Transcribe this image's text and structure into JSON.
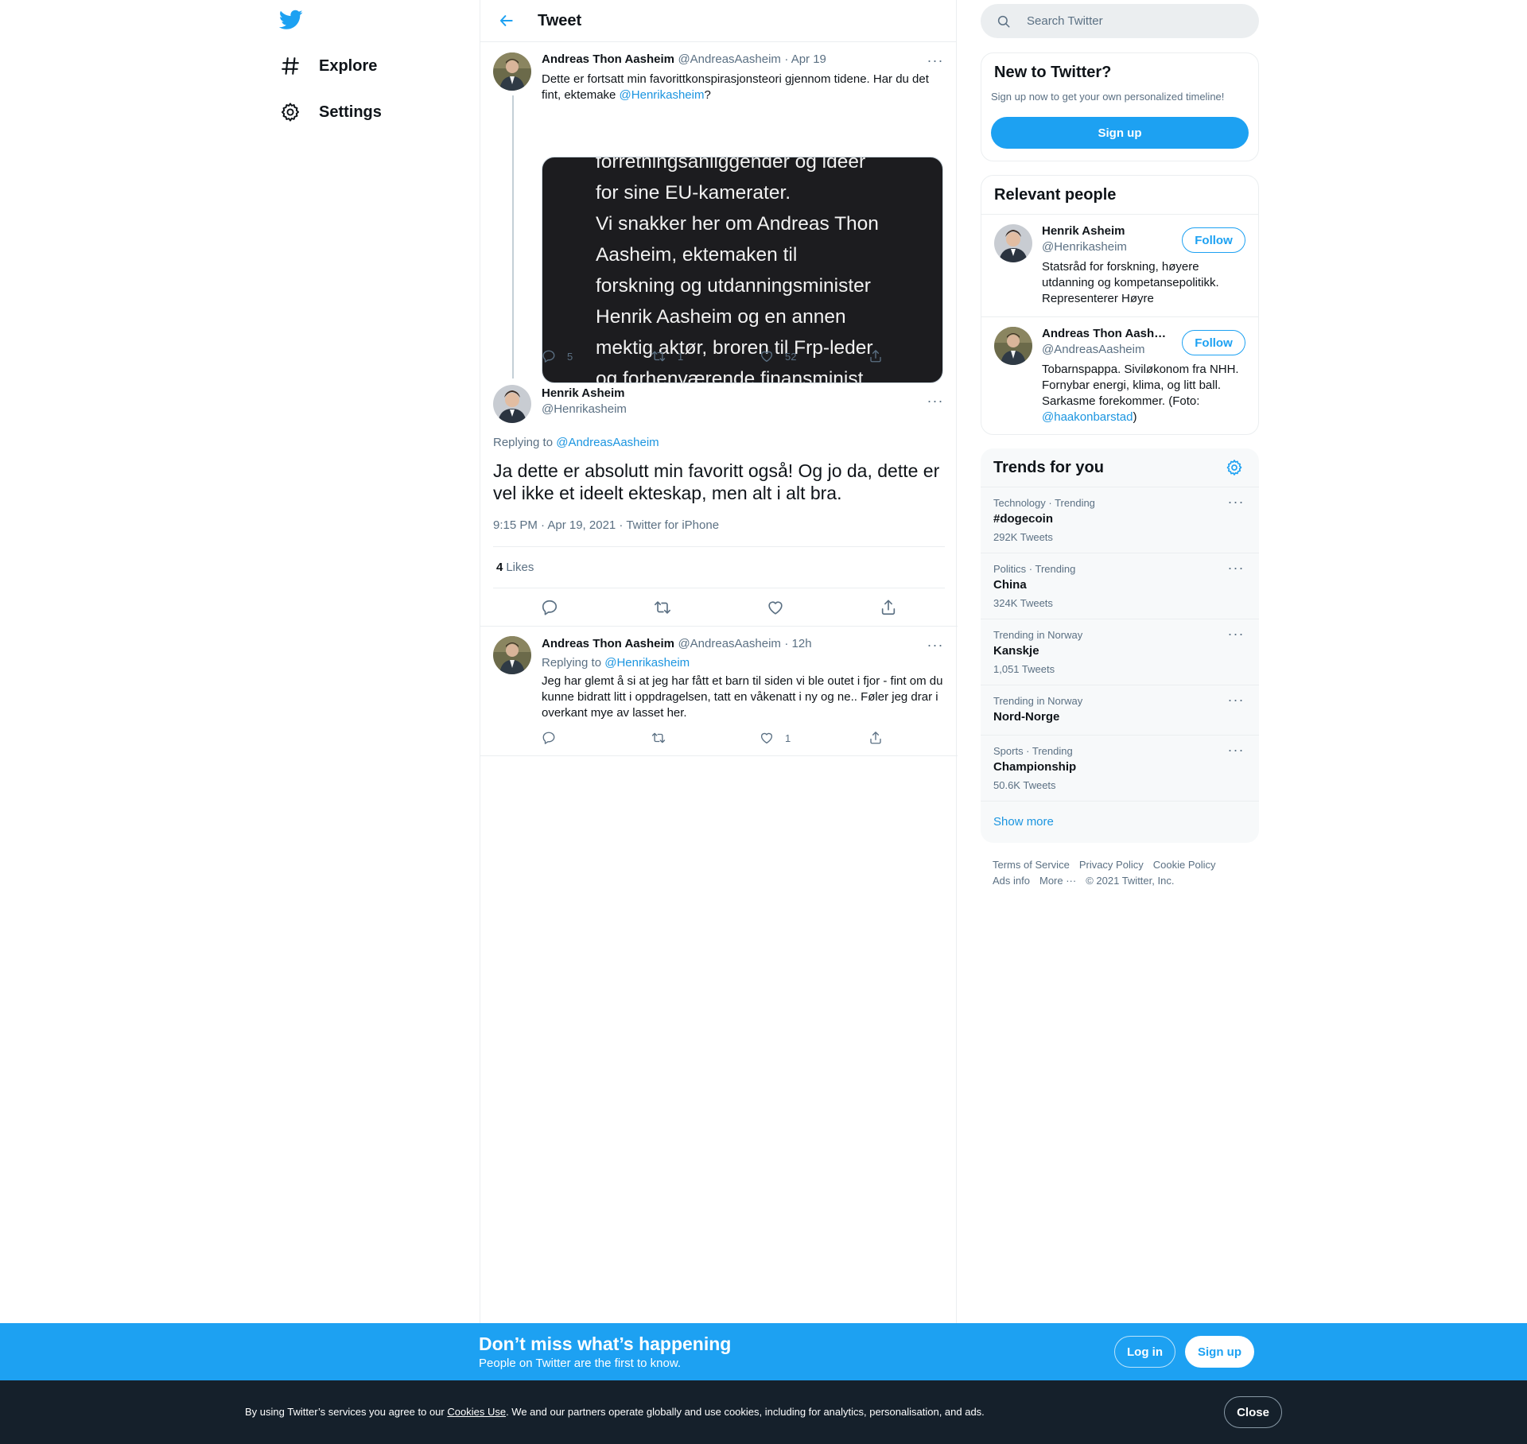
{
  "nav": {
    "explore_label": "Explore",
    "settings_label": "Settings"
  },
  "header": {
    "title": "Tweet"
  },
  "tweet1": {
    "name": "Andreas Thon Aasheim",
    "handle": "@AndreasAasheim",
    "time": "· Apr 19",
    "text_before": "Dette er fortsatt min favorittkonspirasjonsteori gjennom tidene. Har du det fint, ektemake ",
    "mention": "@Henrikasheim",
    "text_after": "?",
    "image_lines": [
      "forretningsanliggender og ideer",
      "for sine EU-kamerater.",
      "Vi snakker her om Andreas Thon",
      "Aasheim, ektemaken til",
      "forskning og utdanningsminister",
      "Henrik Aasheim og en annen",
      "mektig aktør, broren til Frp-leder",
      "og forhenværende finansminist..."
    ],
    "replies": "5",
    "retweets": "1",
    "likes": "52"
  },
  "main_tweet": {
    "name": "Henrik Asheim",
    "handle": "@Henrikasheim",
    "replying_prefix": "Replying to ",
    "replying_to": "@AndreasAasheim",
    "text": "Ja dette er absolutt min favoritt også! Og jo da, dette er vel ikke et ideelt ekteskap, men alt i alt bra.",
    "timestamp": "9:15 PM · Apr 19, 2021 · Twitter for iPhone",
    "likes_count": "4",
    "likes_label": "Likes"
  },
  "reply": {
    "name": "Andreas Thon Aasheim",
    "handle": "@AndreasAasheim",
    "time": "· 12h",
    "replying_prefix": "Replying to ",
    "replying_to": "@Henrikasheim",
    "text": "Jeg har glemt å si at jeg har fått et barn til siden vi ble outet i fjor - fint om du kunne bidratt litt i oppdragelsen, tatt en våkenatt i ny og ne.. Føler jeg drar i overkant mye av lasset her.",
    "likes": "1"
  },
  "search": {
    "placeholder": "Search Twitter"
  },
  "new_to_twitter": {
    "title": "New to Twitter?",
    "subtitle": "Sign up now to get your own personalized timeline!",
    "button": "Sign up"
  },
  "relevant_people": {
    "title": "Relevant people",
    "people": [
      {
        "name": "Henrik Asheim",
        "handle": "@Henrikasheim",
        "bio": "Statsråd for forskning, høyere utdanning og kompetansepolitikk. Representerer Høyre",
        "follow": "Follow"
      },
      {
        "name": "Andreas Thon Aash…",
        "handle": "@AndreasAasheim",
        "bio_before": "Tobarnspappa. Siviløkonom fra NHH. Fornybar energi, klima, og litt ball. Sarkasme forekommer. (Foto: ",
        "bio_link": "@haakonbarstad",
        "bio_after": ")",
        "follow": "Follow"
      }
    ]
  },
  "trends": {
    "title": "Trends for you",
    "items": [
      {
        "category": "Technology · Trending",
        "name": "#dogecoin",
        "count": "292K Tweets"
      },
      {
        "category": "Politics · Trending",
        "name": "China",
        "count": "324K Tweets"
      },
      {
        "category": "Trending in Norway",
        "name": "Kanskje",
        "count": "1,051 Tweets"
      },
      {
        "category": "Trending in Norway",
        "name": "Nord-Norge",
        "count": ""
      },
      {
        "category": "Sports · Trending",
        "name": "Championship",
        "count": "50.6K Tweets"
      }
    ],
    "show_more": "Show more"
  },
  "footer": {
    "terms": "Terms of Service",
    "privacy": "Privacy Policy",
    "cookie": "Cookie Policy",
    "ads": "Ads info",
    "more": "More ···",
    "copyright": "© 2021 Twitter, Inc."
  },
  "banner": {
    "title": "Don’t miss what’s happening",
    "subtitle": "People on Twitter are the first to know.",
    "login": "Log in",
    "signup": "Sign up"
  },
  "cookie_bar": {
    "text_before": "By using Twitter’s services you agree to our ",
    "link": "Cookies Use",
    "text_after": ". We and our partners operate globally and use cookies, including for analytics, personalisation, and ads.",
    "close": "Close"
  },
  "colors": {
    "accent": "#1da1f2",
    "link": "#1b95e0",
    "muted": "#5b7083",
    "cookie_bg": "#15202b"
  }
}
